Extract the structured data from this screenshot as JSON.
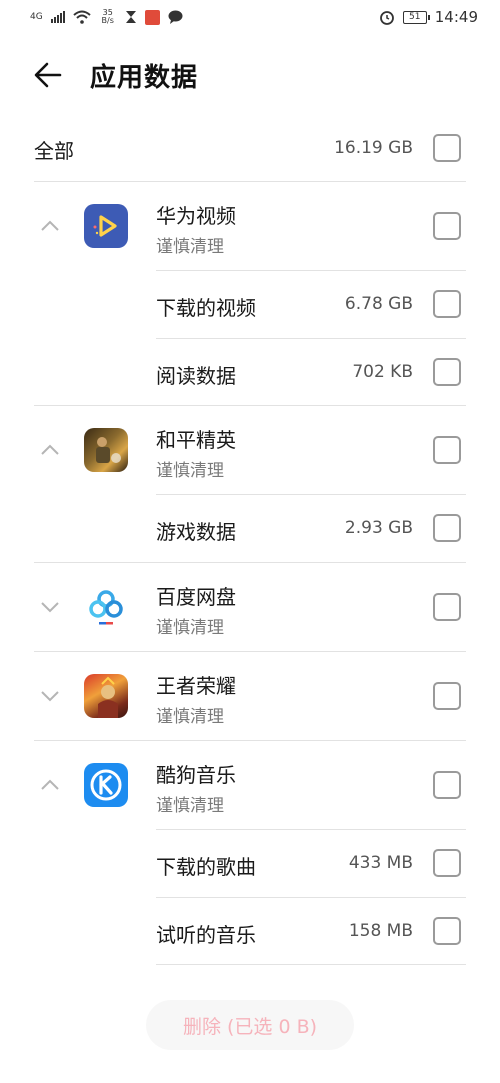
{
  "status_bar": {
    "network_type": "4G",
    "speed_value": "35",
    "speed_unit": "B/s",
    "battery": "51",
    "time": "14:49"
  },
  "header": {
    "title": "应用数据"
  },
  "all": {
    "label": "全部",
    "size": "16.19 GB"
  },
  "apps": [
    {
      "name": "华为视频",
      "note": "谨慎清理",
      "expanded": true,
      "items": [
        {
          "label": "下载的视频",
          "size": "6.78 GB"
        },
        {
          "label": "阅读数据",
          "size": "702 KB"
        }
      ]
    },
    {
      "name": "和平精英",
      "note": "谨慎清理",
      "expanded": true,
      "items": [
        {
          "label": "游戏数据",
          "size": "2.93 GB"
        }
      ]
    },
    {
      "name": "百度网盘",
      "note": "谨慎清理",
      "expanded": false
    },
    {
      "name": "王者荣耀",
      "note": "谨慎清理",
      "expanded": false
    },
    {
      "name": "酷狗音乐",
      "note": "谨慎清理",
      "expanded": true,
      "items": [
        {
          "label": "下载的歌曲",
          "size": "433 MB"
        },
        {
          "label": "试听的音乐",
          "size": "158 MB"
        }
      ]
    }
  ],
  "footer": {
    "delete_label": "删除 (已选 0 B)"
  },
  "colors": {
    "delete_text": "#f6b3bb",
    "checkbox_border": "#9a9a9a",
    "huawei_video_bg": "#3d5bb5",
    "kugou_bg": "#1d8cf0"
  }
}
